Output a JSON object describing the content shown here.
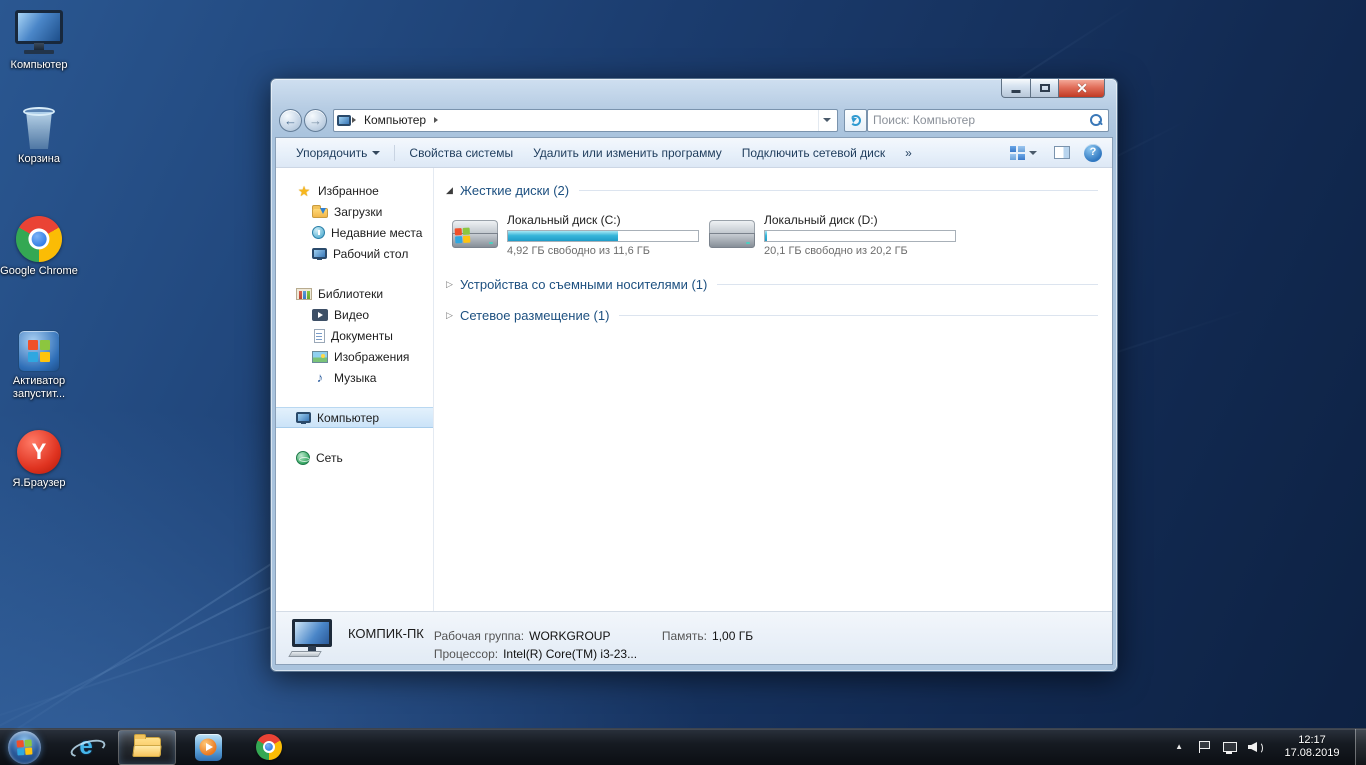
{
  "glyphs": {
    "star": "★",
    "music_note": "♪",
    "help": "?",
    "ie": "e",
    "yandex": "Y",
    "tray_chevron": "▲",
    "group_expanded": "◢",
    "group_collapsed": "▷",
    "back_arrow": "←",
    "forward_arrow": "→"
  },
  "desktop": {
    "icons": [
      {
        "label": "Компьютер"
      },
      {
        "label": "Корзина"
      },
      {
        "label": "Google Chrome"
      },
      {
        "label": "Активатор запустит..."
      },
      {
        "label": "Я.Браузер"
      }
    ]
  },
  "window": {
    "address_bar": {
      "breadcrumb_item": "Компьютер",
      "search_placeholder": "Поиск: Компьютер"
    },
    "toolbar": {
      "organize": "Упорядочить",
      "system_properties": "Свойства системы",
      "uninstall_program": "Удалить или изменить программу",
      "map_network_drive": "Подключить сетевой диск",
      "overflow": "»"
    },
    "sidebar": {
      "favorites": {
        "header": "Избранное",
        "items": [
          "Загрузки",
          "Недавние места",
          "Рабочий стол"
        ]
      },
      "libraries": {
        "header": "Библиотеки",
        "items": [
          "Видео",
          "Документы",
          "Изображения",
          "Музыка"
        ]
      },
      "computer": "Компьютер",
      "network": "Сеть"
    },
    "content": {
      "groups": [
        {
          "label": "Жесткие диски (2)"
        },
        {
          "label": "Устройства со съемными носителями (1)"
        },
        {
          "label": "Сетевое размещение (1)"
        }
      ],
      "drives": [
        {
          "name": "Локальный диск (C:)",
          "free_text": "4,92 ГБ свободно из 11,6 ГБ",
          "used_pct": 58
        },
        {
          "name": "Локальный диск (D:)",
          "free_text": "20,1 ГБ свободно из 20,2 ГБ",
          "used_pct": 1
        }
      ]
    },
    "details_pane": {
      "computer_name": "КОМПИК-ПК",
      "workgroup_label": "Рабочая группа:",
      "workgroup_value": "WORKGROUP",
      "memory_label": "Память:",
      "memory_value": "1,00 ГБ",
      "processor_label": "Процессор:",
      "processor_value": "Intel(R) Core(TM) i3-23..."
    }
  },
  "taskbar": {
    "clock": {
      "time": "12:17",
      "date": "17.08.2019"
    }
  },
  "colors": {
    "capacity_fill": "#38b6da",
    "close_button": "#d9553f",
    "selection": "#cbe3f8"
  }
}
